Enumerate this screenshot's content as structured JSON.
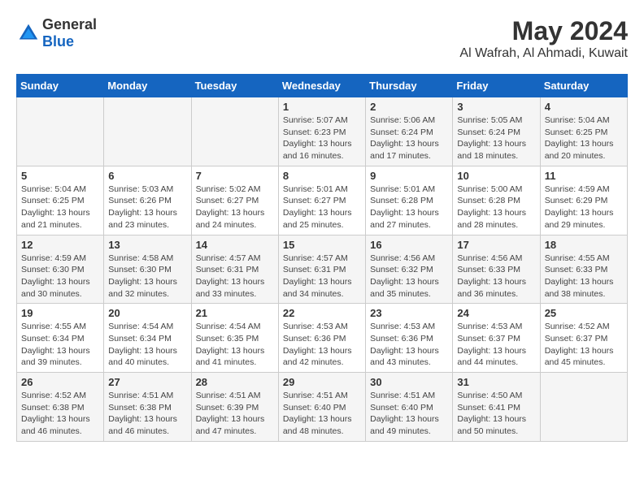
{
  "header": {
    "logo_general": "General",
    "logo_blue": "Blue",
    "title": "May 2024",
    "subtitle": "Al Wafrah, Al Ahmadi, Kuwait"
  },
  "days_of_week": [
    "Sunday",
    "Monday",
    "Tuesday",
    "Wednesday",
    "Thursday",
    "Friday",
    "Saturday"
  ],
  "weeks": [
    [
      {
        "day": "",
        "info": ""
      },
      {
        "day": "",
        "info": ""
      },
      {
        "day": "",
        "info": ""
      },
      {
        "day": "1",
        "info": "Sunrise: 5:07 AM\nSunset: 6:23 PM\nDaylight: 13 hours\nand 16 minutes."
      },
      {
        "day": "2",
        "info": "Sunrise: 5:06 AM\nSunset: 6:24 PM\nDaylight: 13 hours\nand 17 minutes."
      },
      {
        "day": "3",
        "info": "Sunrise: 5:05 AM\nSunset: 6:24 PM\nDaylight: 13 hours\nand 18 minutes."
      },
      {
        "day": "4",
        "info": "Sunrise: 5:04 AM\nSunset: 6:25 PM\nDaylight: 13 hours\nand 20 minutes."
      }
    ],
    [
      {
        "day": "5",
        "info": "Sunrise: 5:04 AM\nSunset: 6:25 PM\nDaylight: 13 hours\nand 21 minutes."
      },
      {
        "day": "6",
        "info": "Sunrise: 5:03 AM\nSunset: 6:26 PM\nDaylight: 13 hours\nand 23 minutes."
      },
      {
        "day": "7",
        "info": "Sunrise: 5:02 AM\nSunset: 6:27 PM\nDaylight: 13 hours\nand 24 minutes."
      },
      {
        "day": "8",
        "info": "Sunrise: 5:01 AM\nSunset: 6:27 PM\nDaylight: 13 hours\nand 25 minutes."
      },
      {
        "day": "9",
        "info": "Sunrise: 5:01 AM\nSunset: 6:28 PM\nDaylight: 13 hours\nand 27 minutes."
      },
      {
        "day": "10",
        "info": "Sunrise: 5:00 AM\nSunset: 6:28 PM\nDaylight: 13 hours\nand 28 minutes."
      },
      {
        "day": "11",
        "info": "Sunrise: 4:59 AM\nSunset: 6:29 PM\nDaylight: 13 hours\nand 29 minutes."
      }
    ],
    [
      {
        "day": "12",
        "info": "Sunrise: 4:59 AM\nSunset: 6:30 PM\nDaylight: 13 hours\nand 30 minutes."
      },
      {
        "day": "13",
        "info": "Sunrise: 4:58 AM\nSunset: 6:30 PM\nDaylight: 13 hours\nand 32 minutes."
      },
      {
        "day": "14",
        "info": "Sunrise: 4:57 AM\nSunset: 6:31 PM\nDaylight: 13 hours\nand 33 minutes."
      },
      {
        "day": "15",
        "info": "Sunrise: 4:57 AM\nSunset: 6:31 PM\nDaylight: 13 hours\nand 34 minutes."
      },
      {
        "day": "16",
        "info": "Sunrise: 4:56 AM\nSunset: 6:32 PM\nDaylight: 13 hours\nand 35 minutes."
      },
      {
        "day": "17",
        "info": "Sunrise: 4:56 AM\nSunset: 6:33 PM\nDaylight: 13 hours\nand 36 minutes."
      },
      {
        "day": "18",
        "info": "Sunrise: 4:55 AM\nSunset: 6:33 PM\nDaylight: 13 hours\nand 38 minutes."
      }
    ],
    [
      {
        "day": "19",
        "info": "Sunrise: 4:55 AM\nSunset: 6:34 PM\nDaylight: 13 hours\nand 39 minutes."
      },
      {
        "day": "20",
        "info": "Sunrise: 4:54 AM\nSunset: 6:34 PM\nDaylight: 13 hours\nand 40 minutes."
      },
      {
        "day": "21",
        "info": "Sunrise: 4:54 AM\nSunset: 6:35 PM\nDaylight: 13 hours\nand 41 minutes."
      },
      {
        "day": "22",
        "info": "Sunrise: 4:53 AM\nSunset: 6:36 PM\nDaylight: 13 hours\nand 42 minutes."
      },
      {
        "day": "23",
        "info": "Sunrise: 4:53 AM\nSunset: 6:36 PM\nDaylight: 13 hours\nand 43 minutes."
      },
      {
        "day": "24",
        "info": "Sunrise: 4:53 AM\nSunset: 6:37 PM\nDaylight: 13 hours\nand 44 minutes."
      },
      {
        "day": "25",
        "info": "Sunrise: 4:52 AM\nSunset: 6:37 PM\nDaylight: 13 hours\nand 45 minutes."
      }
    ],
    [
      {
        "day": "26",
        "info": "Sunrise: 4:52 AM\nSunset: 6:38 PM\nDaylight: 13 hours\nand 46 minutes."
      },
      {
        "day": "27",
        "info": "Sunrise: 4:51 AM\nSunset: 6:38 PM\nDaylight: 13 hours\nand 46 minutes."
      },
      {
        "day": "28",
        "info": "Sunrise: 4:51 AM\nSunset: 6:39 PM\nDaylight: 13 hours\nand 47 minutes."
      },
      {
        "day": "29",
        "info": "Sunrise: 4:51 AM\nSunset: 6:40 PM\nDaylight: 13 hours\nand 48 minutes."
      },
      {
        "day": "30",
        "info": "Sunrise: 4:51 AM\nSunset: 6:40 PM\nDaylight: 13 hours\nand 49 minutes."
      },
      {
        "day": "31",
        "info": "Sunrise: 4:50 AM\nSunset: 6:41 PM\nDaylight: 13 hours\nand 50 minutes."
      },
      {
        "day": "",
        "info": ""
      }
    ]
  ]
}
